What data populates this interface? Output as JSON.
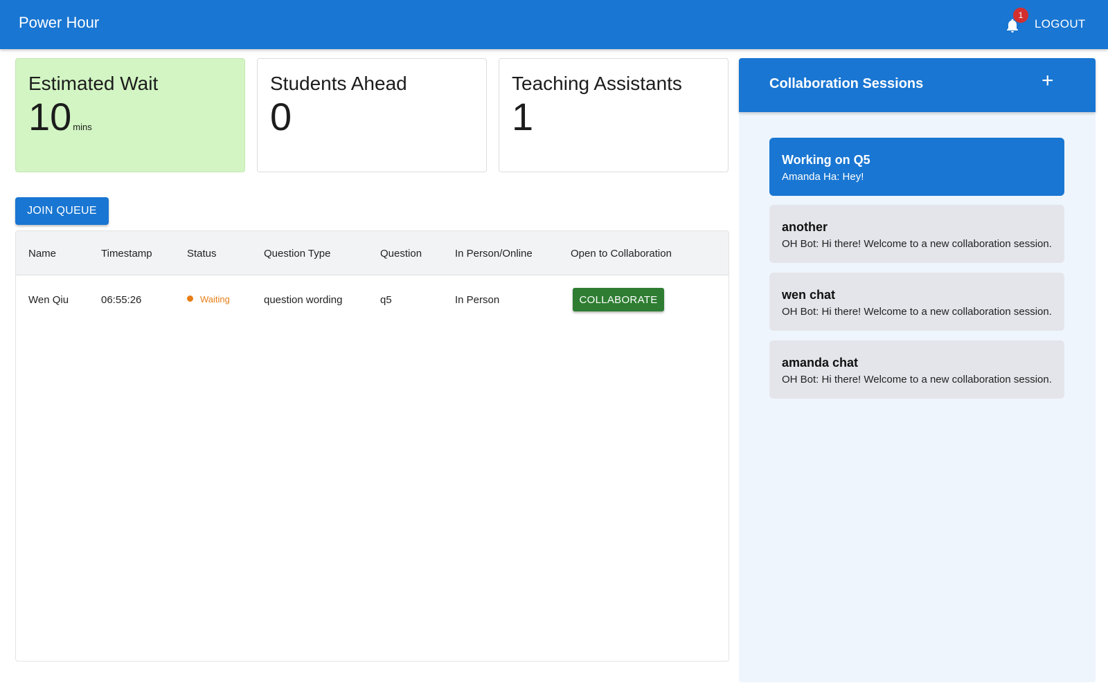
{
  "app": {
    "title": "Power Hour",
    "notification_count": "1",
    "logout_label": "LOGOUT"
  },
  "stats": {
    "wait": {
      "label": "Estimated Wait",
      "value": "10",
      "unit": "mins"
    },
    "ahead": {
      "label": "Students Ahead",
      "value": "0"
    },
    "tas": {
      "label": "Teaching Assistants",
      "value": "1"
    }
  },
  "queue": {
    "join_label": "JOIN QUEUE",
    "columns": [
      "Name",
      "Timestamp",
      "Status",
      "Question Type",
      "Question",
      "In Person/Online",
      "Open to Collaboration"
    ],
    "rows": [
      {
        "name": "Wen Qiu",
        "timestamp": "06:55:26",
        "status": "Waiting",
        "question_type": "question wording",
        "question": "q5",
        "mode": "In Person",
        "action": "COLLABORATE"
      }
    ]
  },
  "collab": {
    "title": "Collaboration Sessions",
    "add_label": "+",
    "sessions": [
      {
        "name": "Working on Q5",
        "last_message": "Amanda Ha: Hey!"
      },
      {
        "name": "another",
        "last_message": "OH Bot: Hi there! Welcome to a new collaboration session."
      },
      {
        "name": "wen chat",
        "last_message": "OH Bot: Hi there! Welcome to a new collaboration session."
      },
      {
        "name": "amanda chat",
        "last_message": "OH Bot: Hi there! Welcome to a new collaboration session."
      }
    ]
  },
  "colors": {
    "primary": "#1976d2",
    "success": "#2e7d32",
    "warning": "#e67e17",
    "wait_card_bg": "#d2f5c3",
    "badge": "#d32f2f"
  },
  "icons": {
    "notifications": "bell-icon",
    "add_session": "plus-icon",
    "status": "status-dot-icon"
  }
}
